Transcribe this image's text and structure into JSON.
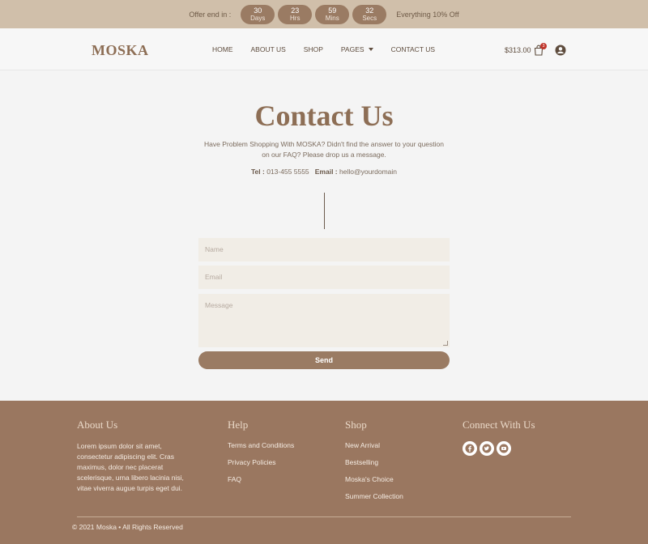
{
  "topbar": {
    "offer_label": "Offer end in :",
    "countdown": [
      {
        "value": "30",
        "unit": "Days"
      },
      {
        "value": "23",
        "unit": "Hrs"
      },
      {
        "value": "59",
        "unit": "Mins"
      },
      {
        "value": "32",
        "unit": "Secs"
      }
    ],
    "offer_note": "Everything 10% Off"
  },
  "header": {
    "logo": "MOSKA",
    "nav": [
      "HOME",
      "ABOUT US",
      "SHOP",
      "PAGES",
      "CONTACT US"
    ],
    "cart_total": "$313.00",
    "cart_count": "3"
  },
  "main": {
    "title": "Contact Us",
    "intro_1": "Have Problem Shopping With MOSKA? Didn't find the answer to your question",
    "intro_2": "on our FAQ? Please drop us a message.",
    "tel_label": "Tel :",
    "tel_value": "013-455 5555",
    "email_label": "Email :",
    "email_value": "hello@yourdomain",
    "form": {
      "name_placeholder": "Name",
      "email_placeholder": "Email",
      "message_placeholder": "Message",
      "send_label": "Send"
    }
  },
  "footer": {
    "about_title": "About Us",
    "about_text": "Lorem ipsum dolor sit amet, consectetur adipiscing elit. Cras maximus, dolor nec placerat scelerisque, urna libero lacinia nisi, vitae viverra augue turpis eget dui.",
    "help_title": "Help",
    "help_links": [
      "Terms and Conditions",
      "Privacy Policies",
      "FAQ"
    ],
    "shop_title": "Shop",
    "shop_links": [
      "New Arrival",
      "Bestselling",
      "Moska's Choice",
      "Summer Collection"
    ],
    "connect_title": "Connect With Us",
    "social_icons": [
      "facebook-icon",
      "twitter-icon",
      "youtube-icon"
    ],
    "copyright": "© 2021 Moska • All Rights Reserved"
  },
  "colors": {
    "topbar_bg": "#d0bfaa",
    "accent": "#9a7b63",
    "brand_text": "#8d6e55",
    "footer_bg": "#9a7760",
    "field_bg": "#f1ede6"
  }
}
